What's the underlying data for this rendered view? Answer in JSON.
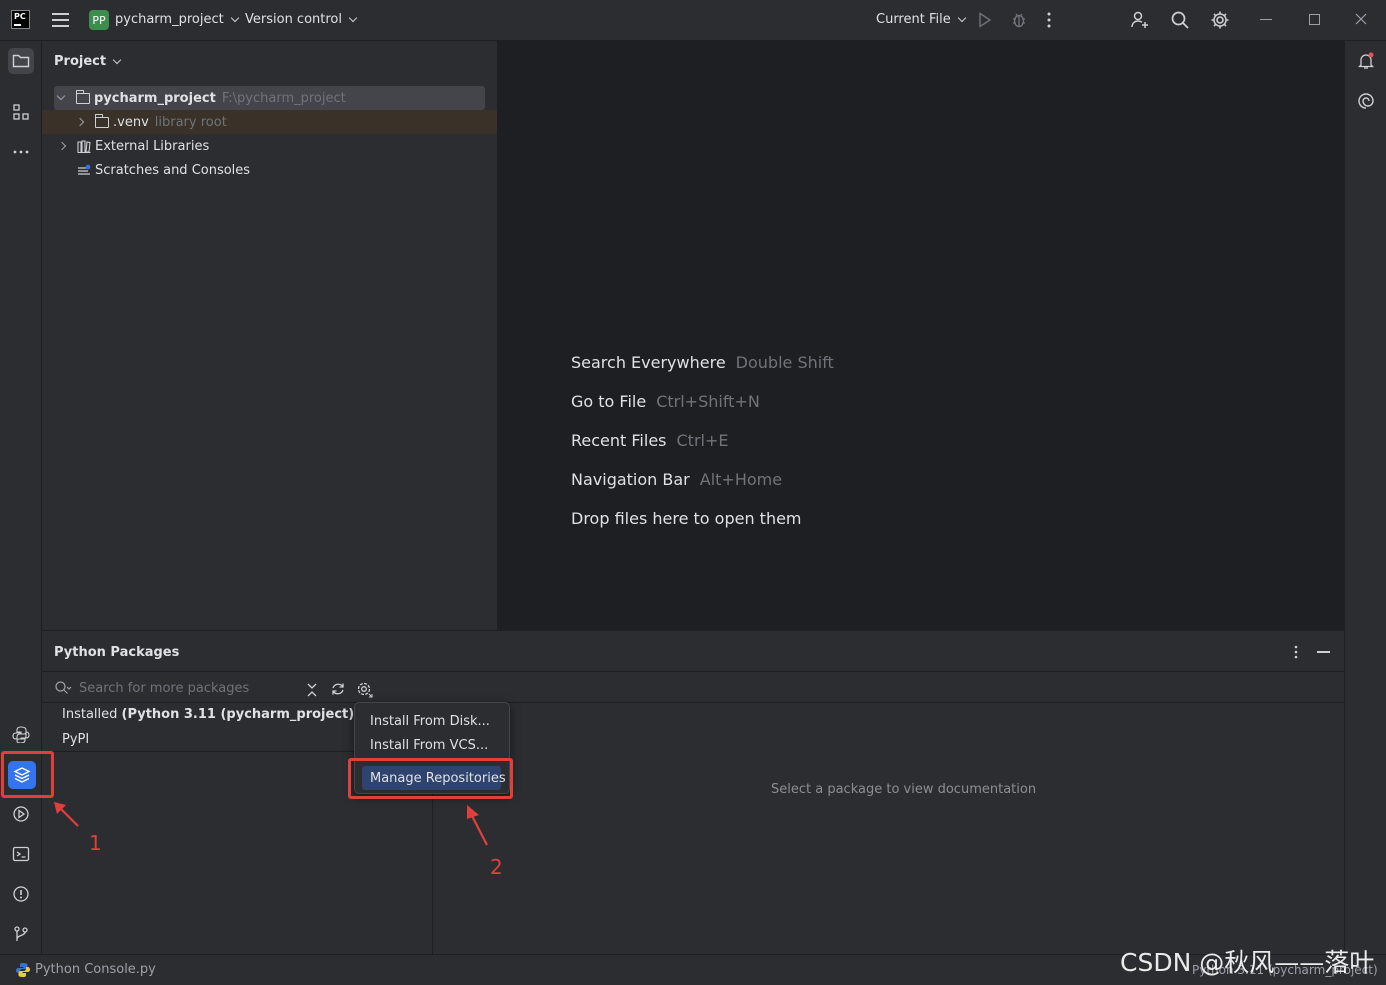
{
  "titlebar": {
    "app_logo": "PC",
    "project_badge": "PP",
    "project_name": "pycharm_project",
    "version_control": "Version control",
    "run_config": "Current File"
  },
  "project_panel": {
    "title": "Project",
    "tree": [
      {
        "name": "pycharm_project",
        "hint": "F:\\pycharm_project"
      },
      {
        "name": ".venv",
        "hint": "library root"
      },
      {
        "name": "External Libraries"
      },
      {
        "name": "Scratches and Consoles"
      }
    ]
  },
  "editor": {
    "hints": [
      {
        "label": "Search Everywhere",
        "shortcut": "Double Shift"
      },
      {
        "label": "Go to File",
        "shortcut": "Ctrl+Shift+N"
      },
      {
        "label": "Recent Files",
        "shortcut": "Ctrl+E"
      },
      {
        "label": "Navigation Bar",
        "shortcut": "Alt+Home"
      },
      {
        "label": "Drop files here to open them",
        "shortcut": ""
      }
    ]
  },
  "packages": {
    "title": "Python Packages",
    "search_placeholder": "Search for more packages",
    "installed_prefix": "Installed ",
    "installed_env": "(Python 3.11 (pycharm_project))",
    "pypi": "PyPI",
    "doc_hint": "Select a package to view documentation"
  },
  "popup": {
    "items": [
      "Install From Disk...",
      "Install From VCS...",
      "Manage Repositories"
    ]
  },
  "annotations": {
    "one": "1",
    "two": "2"
  },
  "status": {
    "left": "Python Console.py",
    "right": "Python 3.11 (pycharm_project)"
  },
  "watermark": "CSDN @秋风——落叶",
  "colors": {
    "accent": "#3574f0",
    "annotation": "#e0403c",
    "background": "#1e1f22",
    "panel": "#2b2d30"
  }
}
